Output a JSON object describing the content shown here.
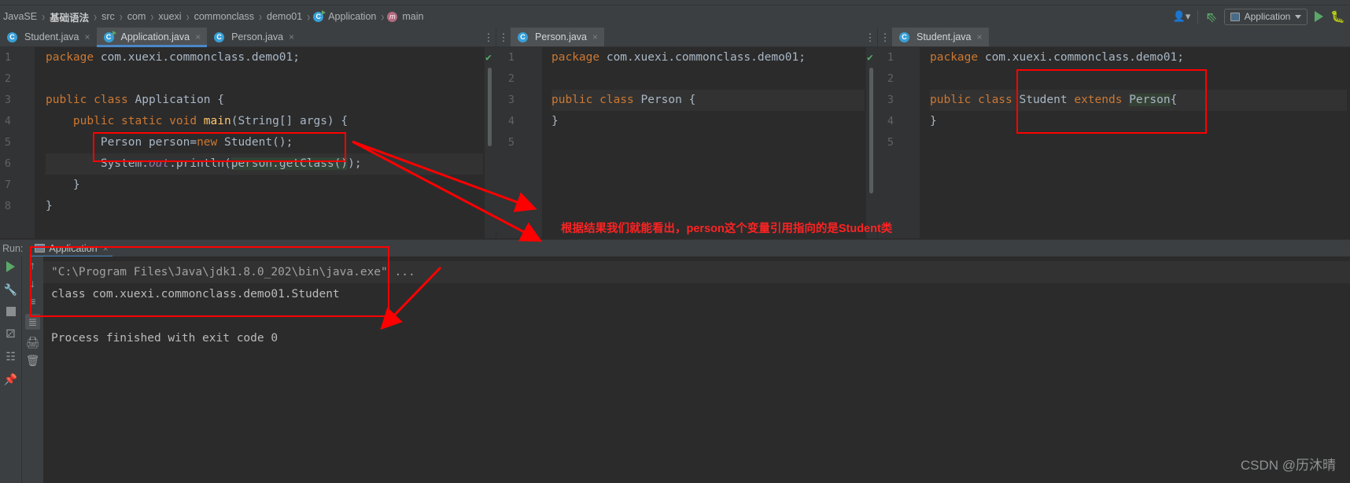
{
  "navbar": {
    "breadcrumbs": [
      {
        "label": "JavaSE",
        "icon": "",
        "bold": false
      },
      {
        "label": "基础语法",
        "icon": "",
        "bold": true
      },
      {
        "label": "src",
        "icon": "",
        "bold": false
      },
      {
        "label": "com",
        "icon": "",
        "bold": false
      },
      {
        "label": "xuexi",
        "icon": "",
        "bold": false
      },
      {
        "label": "commonclass",
        "icon": "",
        "bold": false
      },
      {
        "label": "demo01",
        "icon": "",
        "bold": false
      },
      {
        "label": "Application",
        "icon": "class-runnable-icon",
        "bold": false
      },
      {
        "label": "main",
        "icon": "method-icon",
        "bold": false
      }
    ],
    "separator": "›",
    "right": {
      "people_icon": "people-icon",
      "updates_icon": "update-arrow-icon",
      "run_config_label": "Application",
      "run_icon": "run-play-icon",
      "debug_icon": "debug-bug-icon"
    }
  },
  "editors": [
    {
      "pane": "left",
      "tabs": [
        {
          "label": "Student.java",
          "icon": "java-class-icon",
          "active": false,
          "close": "×"
        },
        {
          "label": "Application.java",
          "icon": "java-class-runnable-icon",
          "active": true,
          "close": "×"
        },
        {
          "label": "Person.java",
          "icon": "java-class-icon",
          "active": false,
          "close": "×"
        }
      ],
      "gutter_numbers": [
        "1",
        "2",
        "3",
        "4",
        "5",
        "6",
        "7",
        "8"
      ],
      "lines": [
        {
          "n": 1,
          "text": "package com.xuexi.commonclass.demo01;"
        },
        {
          "n": 2,
          "text": ""
        },
        {
          "n": 3,
          "text": "public class Application {"
        },
        {
          "n": 4,
          "text": "    public static void main(String[] args) {"
        },
        {
          "n": 5,
          "text": "        Person person=new Student();"
        },
        {
          "n": 6,
          "text": "        System.out.println(person.getClass());"
        },
        {
          "n": 7,
          "text": "    }"
        },
        {
          "n": 8,
          "text": "}"
        }
      ],
      "status": "ok-check"
    },
    {
      "pane": "middle",
      "tabs": [
        {
          "label": "Person.java",
          "icon": "java-class-icon",
          "active": true,
          "close": "×"
        }
      ],
      "gutter_numbers": [
        "1",
        "2",
        "3",
        "4",
        "5"
      ],
      "lines": [
        {
          "n": 1,
          "text": "package com.xuexi.commonclass.demo01;"
        },
        {
          "n": 2,
          "text": ""
        },
        {
          "n": 3,
          "text": "public class Person {"
        },
        {
          "n": 4,
          "text": "}"
        },
        {
          "n": 5,
          "text": ""
        }
      ],
      "status": "ok-check"
    },
    {
      "pane": "right",
      "tabs": [
        {
          "label": "Student.java",
          "icon": "java-class-icon",
          "active": true,
          "close": "×"
        }
      ],
      "gutter_numbers": [
        "1",
        "2",
        "3",
        "4",
        "5"
      ],
      "lines": [
        {
          "n": 1,
          "text": "package com.xuexi.commonclass.demo01;"
        },
        {
          "n": 2,
          "text": ""
        },
        {
          "n": 3,
          "text": "public class Student extends Person{"
        },
        {
          "n": 4,
          "text": "}"
        },
        {
          "n": 5,
          "text": ""
        }
      ],
      "status": "ok-check"
    }
  ],
  "run_window": {
    "label": "Run:",
    "tab_label": "Application",
    "tab_close": "×",
    "rail_icons": [
      "rerun-play-icon",
      "settings-wrench-icon",
      "stop-icon",
      "coverage-icon",
      "layout-icon"
    ],
    "tool_icons": [
      "scroll-up-icon",
      "scroll-down-icon",
      "soft-wrap-icon",
      "scroll-to-end-icon",
      "print-icon",
      "clear-all-icon",
      "pin-icon"
    ],
    "console_lines": [
      {
        "text": "\"C:\\Program Files\\Java\\jdk1.8.0_202\\bin\\java.exe\" ...",
        "style": "cmd"
      },
      {
        "text": "class com.xuexi.commonclass.demo01.Student",
        "style": "out"
      },
      {
        "text": "",
        "style": "out"
      },
      {
        "text": "Process finished with exit code 0",
        "style": "out"
      }
    ]
  },
  "annotations": {
    "note_text": "根据结果我们就能看出，person这个变量引用指向的是Student类",
    "color": "#ff0000",
    "boxes": [
      {
        "name": "highlight-person-declaration"
      },
      {
        "name": "highlight-student-extends-person"
      },
      {
        "name": "highlight-console-output"
      }
    ]
  },
  "watermark": {
    "text": "CSDN @历沐晴"
  }
}
